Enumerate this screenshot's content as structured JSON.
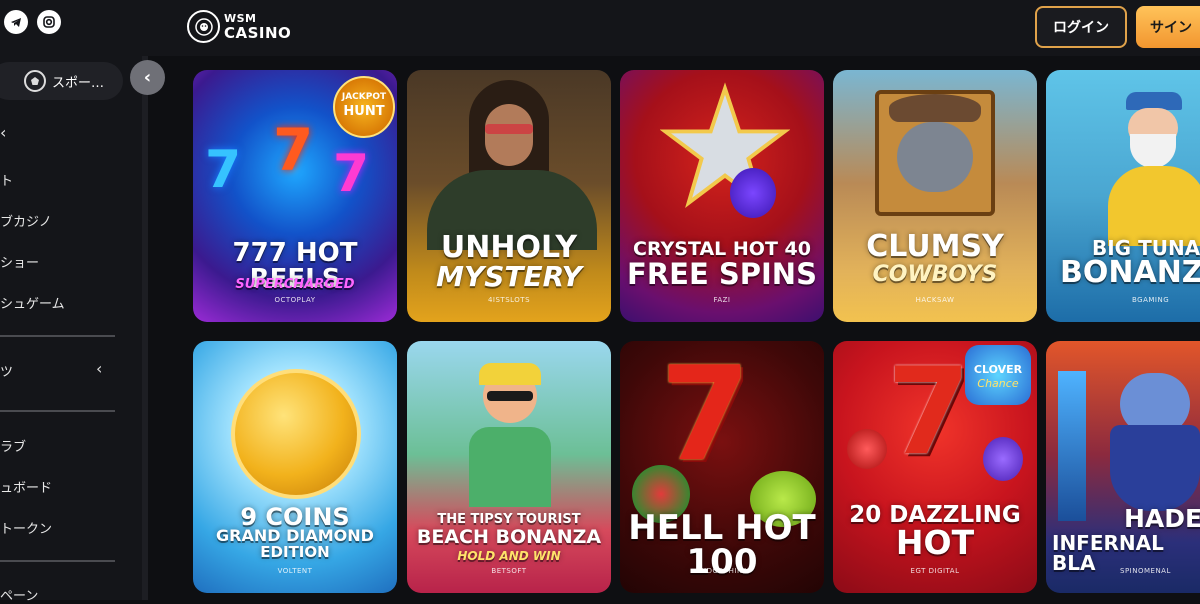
{
  "header": {
    "logo_line1": "WSM",
    "logo_line2": "CASINO",
    "login_label": "ログイン",
    "signup_label": "サイン",
    "social_icons": [
      "telegram-icon",
      "instagram-icon"
    ]
  },
  "sidebar": {
    "sports_label": "スポー…",
    "collapse_icon": "‹",
    "items": [
      {
        "label": "ト"
      },
      {
        "label": "ブカジノ"
      },
      {
        "label": "ショー"
      },
      {
        "label": "シュゲーム"
      },
      {
        "label": "ツ"
      },
      {
        "label": "ラブ"
      },
      {
        "label": "ュボード"
      },
      {
        "label": "トークン"
      },
      {
        "label": "ペーン"
      }
    ]
  },
  "games": [
    {
      "title_line1": "777 HOT REELS",
      "title_line2": "SUPERCHARGED",
      "provider": "OCTOPLAY",
      "badge_line1": "JACKPOT",
      "badge_line2": "HUNT"
    },
    {
      "title_line1": "UNHOLY",
      "title_line2": "MYSTERY",
      "provider": "4ISTSLOTS"
    },
    {
      "title_line1": "CRYSTAL HOT 40",
      "title_line2": "FREE SPINS",
      "provider": "FAZI"
    },
    {
      "title_line1": "CLUMSY",
      "title_line2": "COWBOYS",
      "provider": "HACKSAW"
    },
    {
      "title_line1": "BIG TUNA",
      "title_line2": "BONANZ",
      "provider": "BGAMING"
    },
    {
      "title_line1": "9 COINS",
      "title_line2": "GRAND DIAMOND",
      "title_line3": "EDITION",
      "provider": "VOLTENT"
    },
    {
      "title_line1": "THE TIPSY TOURIST",
      "title_line2": "BEACH BONANZA",
      "title_line3": "HOLD AND WIN",
      "provider": "BETSOFT"
    },
    {
      "title_line1": "HELL HOT 100",
      "provider": "ENDORPHINA"
    },
    {
      "title_line1": "20 DAZZLING",
      "title_line2": "HOT",
      "provider": "EGT DIGITAL",
      "badge_line1": "CLOVER",
      "badge_line2": "Chance"
    },
    {
      "title_line1": "HADES'",
      "title_line2": "INFERNAL BLA",
      "provider": "SPINOMENAL"
    }
  ],
  "colors": {
    "accent": "#f2962f",
    "accent_light": "#ffc35a",
    "bg": "#0e0f12",
    "sidebar": "#141519"
  }
}
